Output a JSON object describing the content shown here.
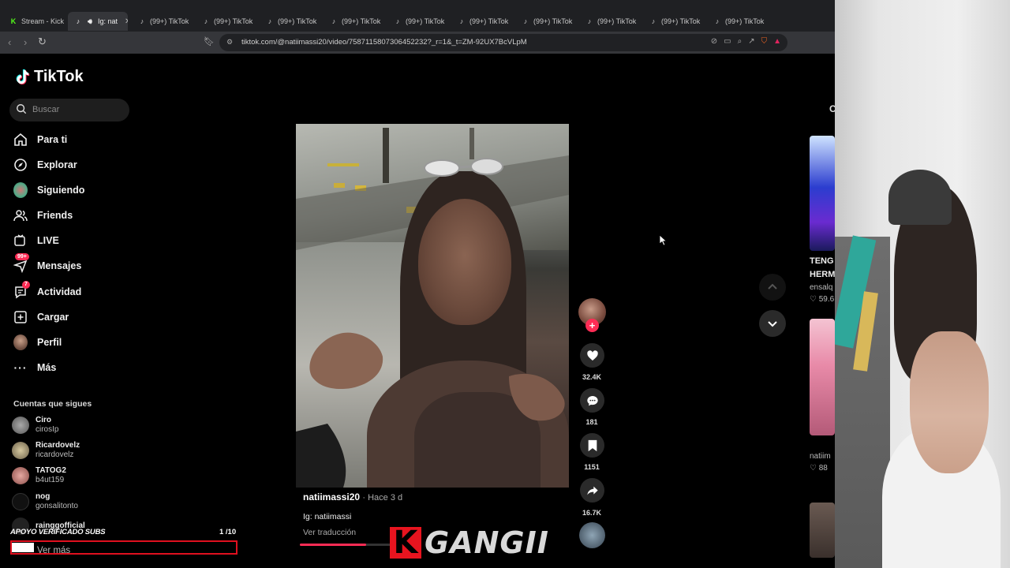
{
  "browser": {
    "tabs": [
      {
        "icon": "kick-icon",
        "label": "Stream - Kick"
      },
      {
        "icon": "tiktok-icon",
        "label": "Ig: nat",
        "active": true,
        "audio": true
      },
      {
        "icon": "tiktok-icon",
        "label": "(99+) TikTok"
      },
      {
        "icon": "tiktok-icon",
        "label": "(99+) TikTok"
      },
      {
        "icon": "tiktok-icon",
        "label": "(99+) TikTok"
      },
      {
        "icon": "tiktok-icon",
        "label": "(99+) TikTok"
      },
      {
        "icon": "tiktok-icon",
        "label": "(99+) TikTok"
      },
      {
        "icon": "tiktok-icon",
        "label": "(99+) TikTok"
      },
      {
        "icon": "tiktok-icon",
        "label": "(99+) TikTok"
      },
      {
        "icon": "tiktok-icon",
        "label": "(99+) TikTok"
      },
      {
        "icon": "tiktok-icon",
        "label": "(99+) TikTok"
      },
      {
        "icon": "tiktok-icon",
        "label": "(99+) TikTok"
      }
    ],
    "url": "tiktok.com/@natiimassi20/video/7587115807306452232?_r=1&_t=ZM-92UX7BcVLpM"
  },
  "sidebar": {
    "logo": "TikTok",
    "search_placeholder": "Buscar",
    "nav": [
      {
        "icon": "home-icon",
        "label": "Para ti"
      },
      {
        "icon": "compass-icon",
        "label": "Explorar"
      },
      {
        "icon": "following-avatar-icon",
        "label": "Siguiendo"
      },
      {
        "icon": "friends-icon",
        "label": "Friends"
      },
      {
        "icon": "live-icon",
        "label": "LIVE"
      },
      {
        "icon": "messages-icon",
        "label": "Mensajes",
        "badge": "99+"
      },
      {
        "icon": "activity-icon",
        "label": "Actividad",
        "badge": "7"
      },
      {
        "icon": "upload-icon",
        "label": "Cargar"
      },
      {
        "icon": "profile-avatar-icon",
        "label": "Perfil"
      },
      {
        "icon": "more-icon",
        "label": "Más"
      }
    ],
    "following_title": "Cuentas que sigues",
    "following": [
      {
        "name": "Ciro",
        "handle": "cirosIp"
      },
      {
        "name": "Ricardovelz",
        "handle": "ricardovelz"
      },
      {
        "name": "TATOG2",
        "handle": "b4ut159"
      },
      {
        "name": "nog",
        "handle": "gonsalitonto"
      },
      {
        "name": "rainggofficial",
        "handle": ""
      }
    ],
    "see_more": "Ver más"
  },
  "stream_overlay": {
    "sub_goal_label": "APOYO VERIFICADO SUBS",
    "sub_goal_count": "1 /10",
    "sub_goal_progress": 0.1,
    "brand_letter": "K",
    "brand_name": "GANGII"
  },
  "video": {
    "author": "natiimassi20",
    "time_ago": "· Hace 3 d",
    "description": "Ig: natiimassi",
    "translate": "Ver traducción",
    "progress": 0.7,
    "likes": "32.4K",
    "comments": "181",
    "saves": "1151",
    "shares": "16.7K"
  },
  "recommendations": {
    "header_partial": "C",
    "items": [
      {
        "title_line1": "TENG",
        "title_line2": "HERM",
        "author": "ensalq",
        "likes": "59.6"
      },
      {
        "title_line1": "",
        "title_line2": "",
        "author": "natiim",
        "likes": "88"
      }
    ]
  },
  "colors": {
    "accent": "#fe2c55",
    "kick_red": "#e8141f",
    "background": "#000000"
  }
}
